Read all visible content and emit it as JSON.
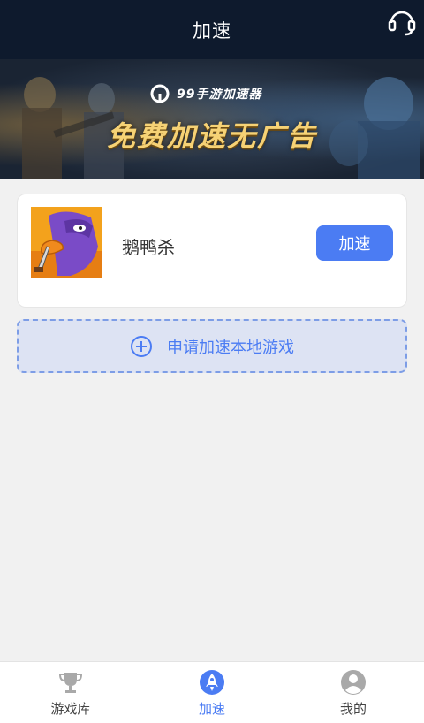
{
  "header": {
    "title": "加速",
    "support_icon": "headset-icon"
  },
  "banner": {
    "logo_text": "99手游加速器",
    "slogan": "免费加速无广告"
  },
  "game_card": {
    "name": "鹅鸭杀",
    "accelerate_label": "加速",
    "icon": "goose-game-icon"
  },
  "apply": {
    "label": "申请加速本地游戏",
    "icon": "plus-circle-icon"
  },
  "tabbar": {
    "tabs": [
      {
        "label": "游戏库",
        "icon": "trophy-icon",
        "active": false
      },
      {
        "label": "加速",
        "icon": "rocket-icon",
        "active": true
      },
      {
        "label": "我的",
        "icon": "user-icon",
        "active": false
      }
    ]
  },
  "colors": {
    "header_bg": "#0e1a2d",
    "accent": "#4b7cf3",
    "page_bg": "#f1f1f1",
    "apply_bg": "#dde3f3"
  }
}
